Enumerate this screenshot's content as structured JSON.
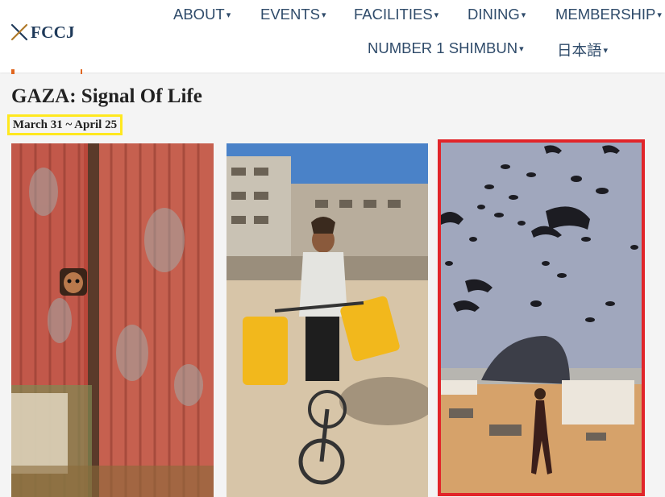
{
  "header": {
    "logo_text": "FCCJ",
    "nav_row1": [
      {
        "label": "ABOUT"
      },
      {
        "label": "EVENTS"
      },
      {
        "label": "FACILITIES"
      },
      {
        "label": "DINING"
      },
      {
        "label": "MEMBERSHIP"
      }
    ],
    "nav_row2": [
      {
        "label": "NUMBER 1 SHIMBUN"
      },
      {
        "label": "日本語"
      }
    ],
    "caret": "▾"
  },
  "page": {
    "title": "GAZA: Signal Of Life",
    "dates": "March 31 ~ April 25"
  },
  "gallery": {
    "photos": [
      {
        "subject": "child-peeking-through-rusted-metal-wall"
      },
      {
        "subject": "girl-on-bicycle-with-yellow-water-jugs"
      },
      {
        "subject": "parachute-aid-airdrop"
      }
    ]
  },
  "colors": {
    "nav_text": "#2f4b6a",
    "logo_text": "#1f3a5a",
    "date_highlight": "#ffe81f",
    "selected_photo_border": "#e1252a",
    "accent_orange": "#e0661f"
  }
}
